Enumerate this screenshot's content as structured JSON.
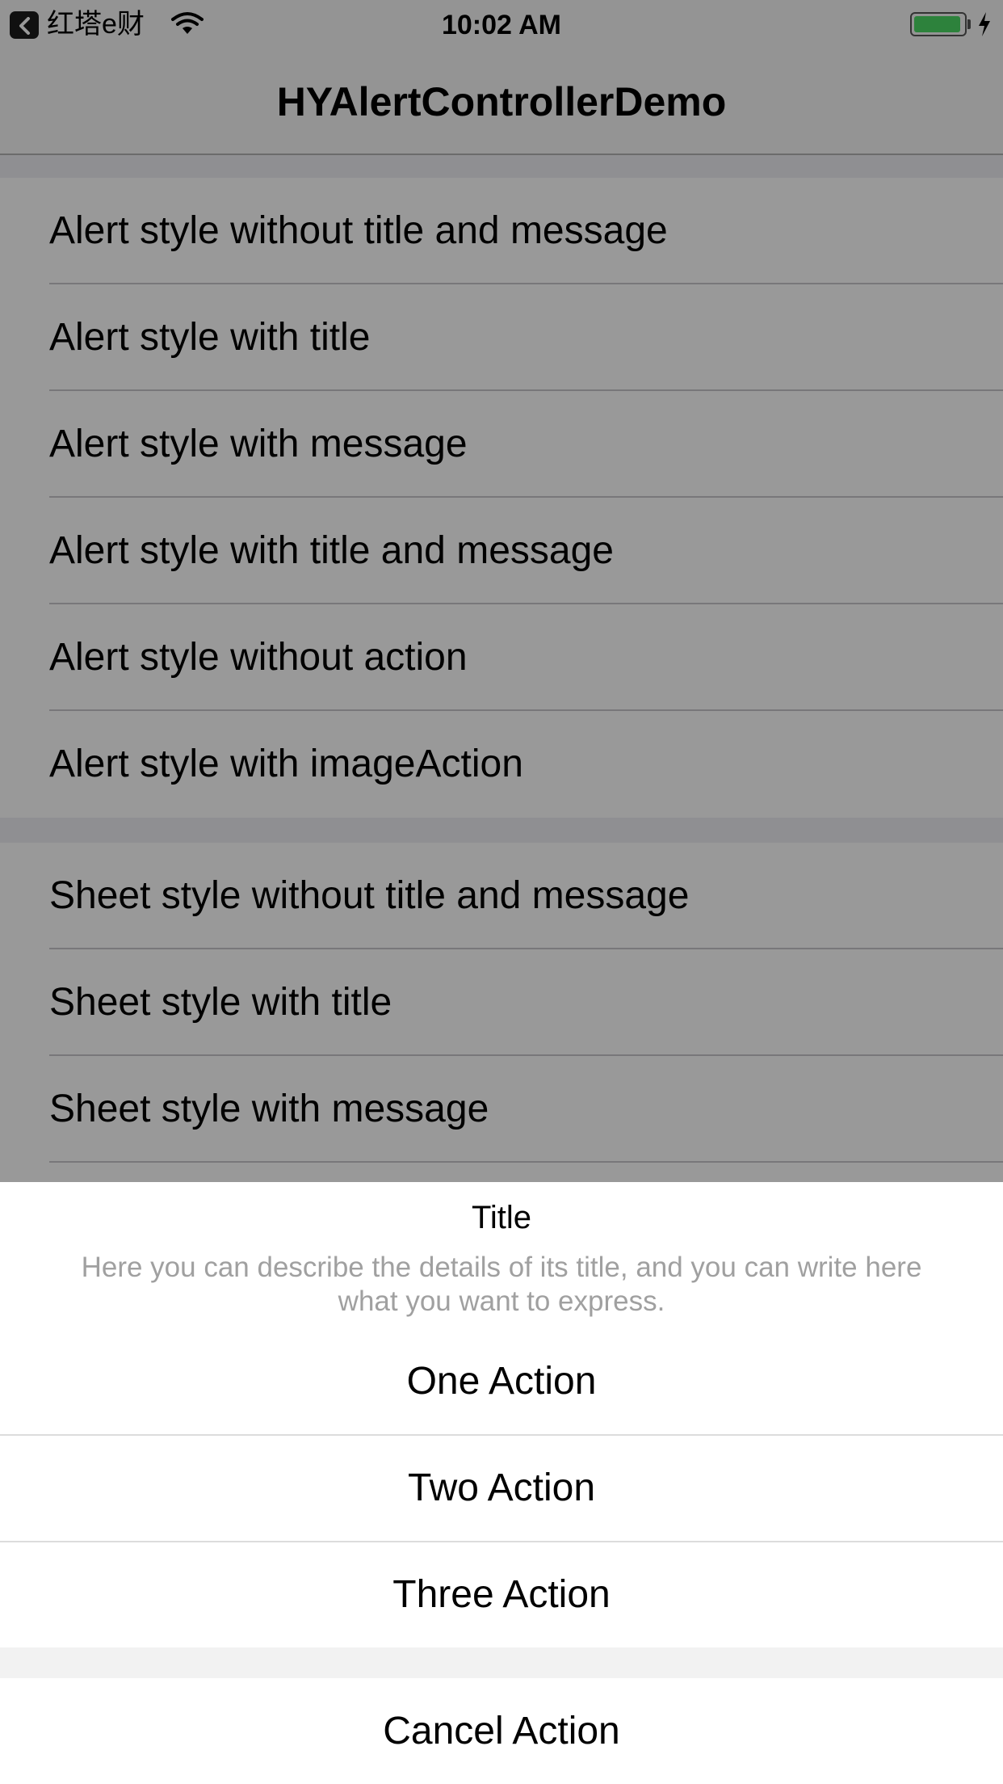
{
  "status_bar": {
    "back_app": "红塔e财",
    "time": "10:02 AM",
    "battery_level": 0.95,
    "battery_color": "#4cd964"
  },
  "nav": {
    "title": "HYAlertControllerDemo"
  },
  "alert_section": {
    "items": [
      {
        "label": "Alert style without title and message"
      },
      {
        "label": "Alert style with title"
      },
      {
        "label": "Alert style with message"
      },
      {
        "label": "Alert style with title and message"
      },
      {
        "label": "Alert style without action"
      },
      {
        "label": "Alert style with imageAction"
      }
    ]
  },
  "sheet_section": {
    "items": [
      {
        "label": "Sheet style without title and message"
      },
      {
        "label": "Sheet style with title"
      },
      {
        "label": "Sheet style with message"
      }
    ]
  },
  "action_sheet": {
    "title": "Title",
    "message": "Here you can describe the details of its title, and you can write here what you want to express.",
    "actions": [
      {
        "label": "One Action"
      },
      {
        "label": "Two Action"
      },
      {
        "label": "Three Action"
      }
    ],
    "cancel": {
      "label": "Cancel Action"
    }
  }
}
